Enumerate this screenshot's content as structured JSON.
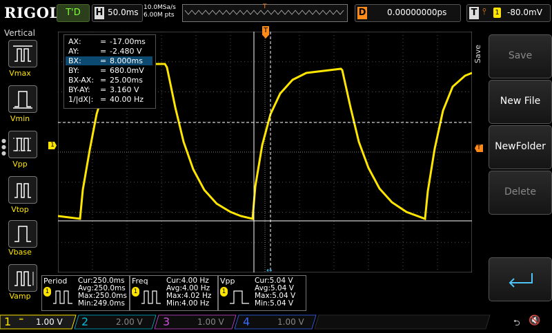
{
  "top": {
    "brand": "RIGOL",
    "run_state": "T'D",
    "h_label": "H",
    "timebase": "50.0ms",
    "sample_rate": "10.0MSa/s",
    "mem_depth": "6.00M pts",
    "d_label": "D",
    "delay": "0.00000000ps",
    "t_label": "T",
    "trigger_source": "1",
    "trigger_level": "-80.0mV"
  },
  "left": {
    "title": "Vertical",
    "items": [
      {
        "label": "Vmax"
      },
      {
        "label": "Vmin"
      },
      {
        "label": "Vpp"
      },
      {
        "label": "Vtop"
      },
      {
        "label": "Vbase"
      },
      {
        "label": "Vamp"
      }
    ]
  },
  "cursor": {
    "rows": [
      {
        "k": "AX:",
        "v": "-17.00ms"
      },
      {
        "k": "AY:",
        "v": "-2.480 V"
      },
      {
        "k": "BX:",
        "v": "8.000ms",
        "selected": true
      },
      {
        "k": "BY:",
        "v": "680.0mV"
      },
      {
        "k": "BX-AX:",
        "v": "25.00ms"
      },
      {
        "k": "BY-AY:",
        "v": "3.160 V"
      },
      {
        "k": "1/|dX|:",
        "v": "40.00 Hz"
      }
    ]
  },
  "markers": {
    "ch1_level": "1",
    "trig_level": "T",
    "trig_pos": "T"
  },
  "menu": {
    "title": "Save",
    "items": [
      {
        "label": "Save",
        "enabled": false
      },
      {
        "label": "New File",
        "enabled": true
      },
      {
        "label": "NewFolder",
        "enabled": true
      },
      {
        "label": "Delete",
        "enabled": false
      }
    ],
    "enter_icon": "return-icon"
  },
  "measurements": [
    {
      "title": "Period",
      "ch": "1",
      "cur": "Cur:250.0ms",
      "avg": "Avg:250.0ms",
      "max": "Max:250.0ms",
      "min": "Min:249.0ms"
    },
    {
      "title": "Freq",
      "ch": "1",
      "cur": "Cur:4.00 Hz",
      "avg": "Avg:4.00 Hz",
      "max": "Max:4.02 Hz",
      "min": "Min:4.00 Hz"
    },
    {
      "title": "Vpp",
      "ch": "1",
      "cur": "Cur:5.04 V",
      "avg": "Avg:5.04 V",
      "max": "Max:5.04 V",
      "min": "Min:5.04 V"
    }
  ],
  "channels": [
    {
      "num": "1",
      "scale": "1.00 V",
      "color": "#ffe600",
      "active": true
    },
    {
      "num": "2",
      "scale": "2.00 V",
      "color": "#00bcd4",
      "active": false
    },
    {
      "num": "3",
      "scale": "1.00 V",
      "color": "#d24ce0",
      "active": false
    },
    {
      "num": "4",
      "scale": "1.00 V",
      "color": "#3a6bff",
      "active": false
    }
  ],
  "colors": {
    "ch1": "#ffe600",
    "trigger": "#ff8c1a",
    "selected_row": "#0c4a72"
  }
}
